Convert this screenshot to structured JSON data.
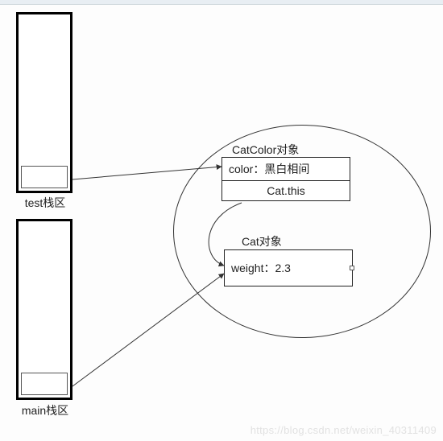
{
  "stacks": {
    "test": {
      "label": "test栈区"
    },
    "main": {
      "label": "main栈区"
    }
  },
  "heap": {
    "catcolor": {
      "title": "CatColor对象",
      "row_color": "color：黑白相间",
      "row_this": "Cat.this"
    },
    "cat": {
      "title": "Cat对象",
      "row_weight": "weight：2.3"
    }
  },
  "watermark": "https://blog.csdn.net/weixin_40311409"
}
